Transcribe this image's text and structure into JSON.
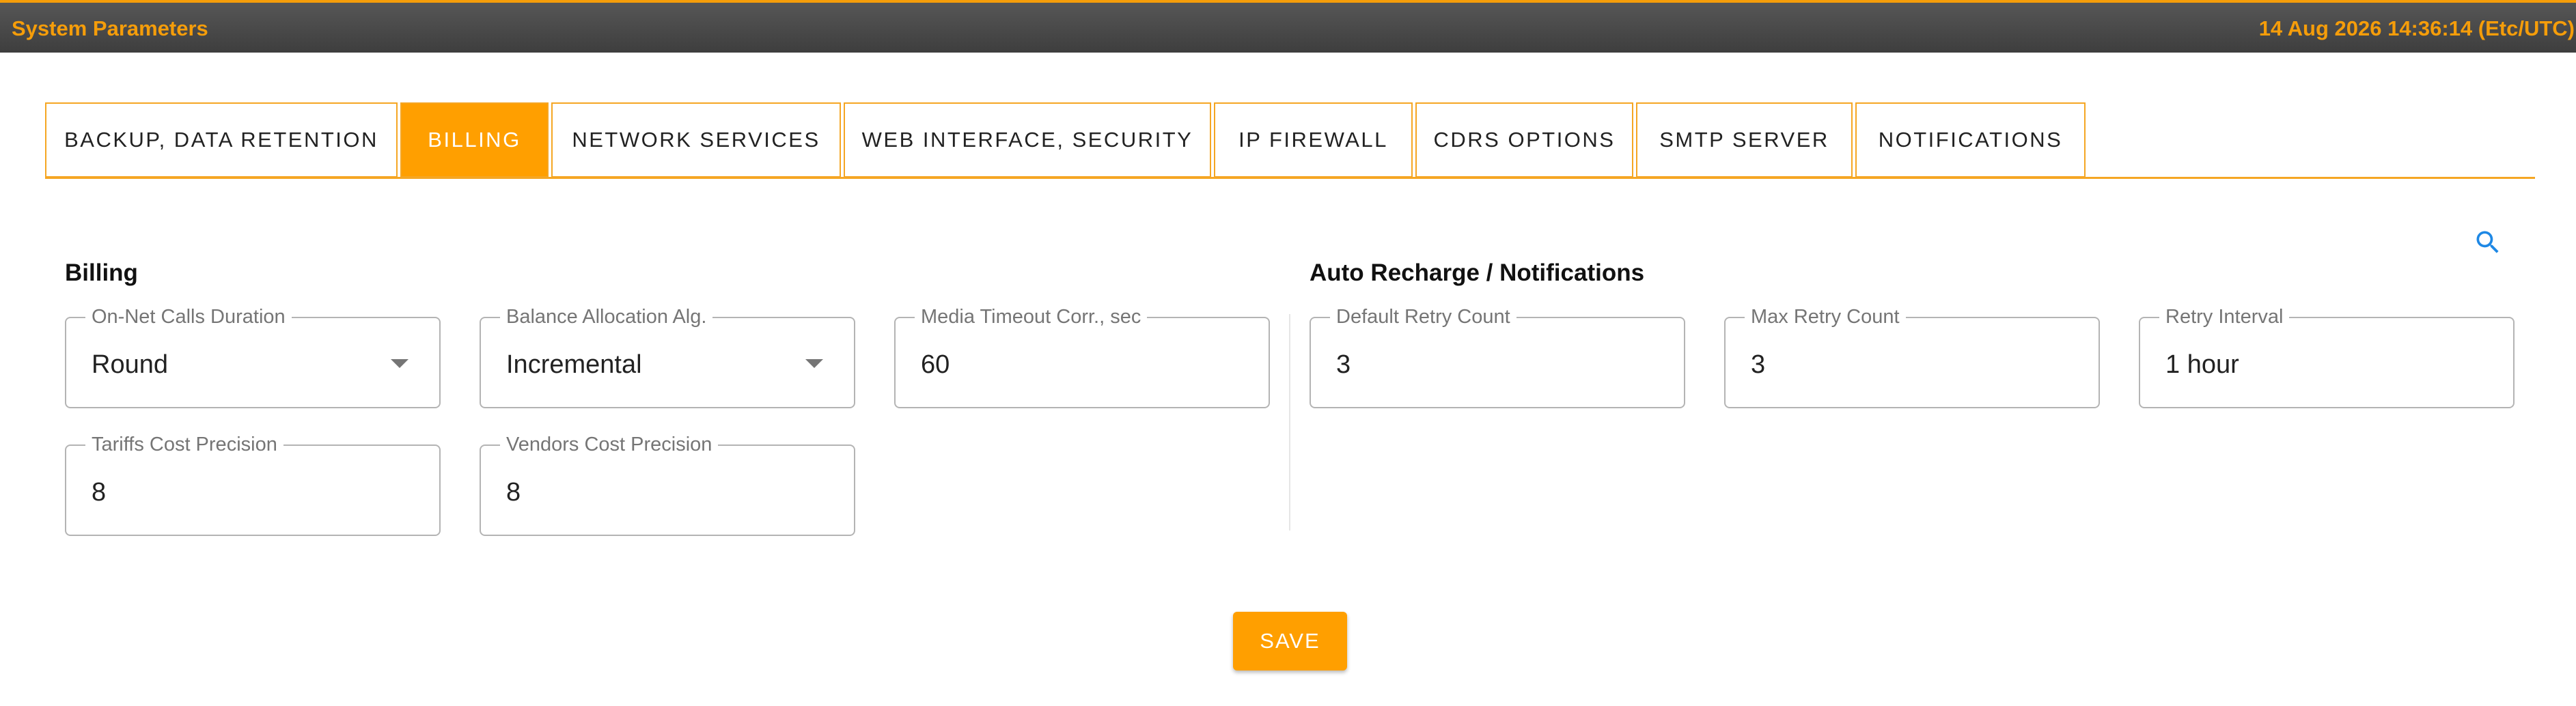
{
  "window": {
    "title": "System Parameters",
    "datetime": "14 Aug 2026 14:36:14 (Etc/UTC)"
  },
  "tabs": [
    {
      "label": "BACKUP, DATA RETENTION",
      "active": false
    },
    {
      "label": "BILLING",
      "active": true
    },
    {
      "label": "NETWORK SERVICES",
      "active": false
    },
    {
      "label": "WEB INTERFACE, SECURITY",
      "active": false
    },
    {
      "label": "IP FIREWALL",
      "active": false
    },
    {
      "label": "CDRS OPTIONS",
      "active": false
    },
    {
      "label": "SMTP SERVER",
      "active": false
    },
    {
      "label": "NOTIFICATIONS",
      "active": false
    }
  ],
  "search": {
    "icon": "search-icon"
  },
  "billing": {
    "title": "Billing",
    "on_net_calls_duration": {
      "label": "On-Net Calls Duration",
      "value": "Round"
    },
    "balance_allocation_alg": {
      "label": "Balance Allocation Alg.",
      "value": "Incremental"
    },
    "media_timeout_corr": {
      "label": "Media Timeout Corr., sec",
      "value": "60"
    },
    "tariffs_cost_precision": {
      "label": "Tariffs Cost Precision",
      "value": "8"
    },
    "vendors_cost_precision": {
      "label": "Vendors Cost Precision",
      "value": "8"
    }
  },
  "auto_recharge": {
    "title": "Auto Recharge / Notifications",
    "default_retry_count": {
      "label": "Default Retry Count",
      "value": "3"
    },
    "max_retry_count": {
      "label": "Max Retry Count",
      "value": "3"
    },
    "retry_interval": {
      "label": "Retry Interval",
      "value": "1 hour"
    }
  },
  "actions": {
    "save_label": "SAVE"
  },
  "colors": {
    "accent": "#ff9f00",
    "header_bg": "#4a4a4a",
    "header_text": "#f59d0a"
  }
}
